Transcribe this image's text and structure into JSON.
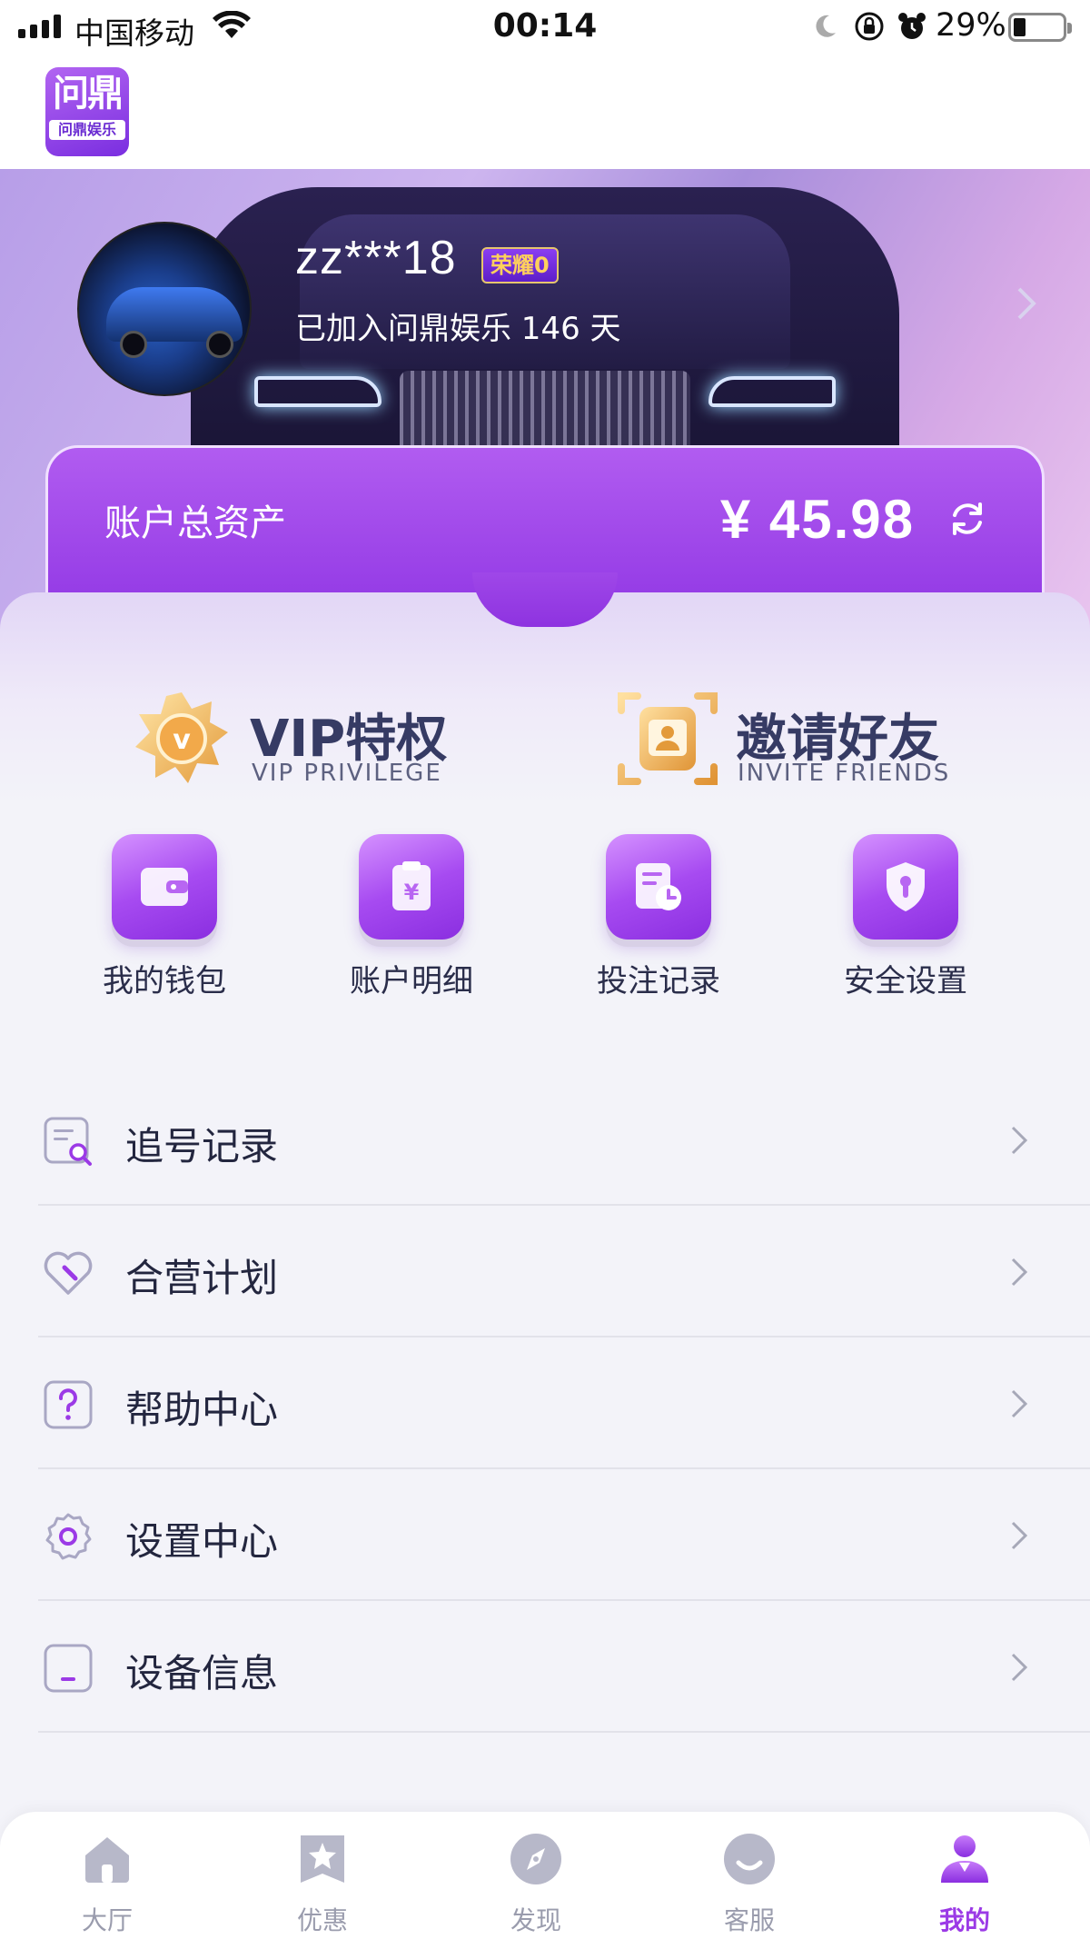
{
  "status_bar": {
    "carrier": "中国移动",
    "time": "00:14",
    "battery": "29%"
  },
  "header": {
    "logo_main": "问鼎",
    "logo_sub": "问鼎娱乐"
  },
  "profile": {
    "username": "zz***18",
    "rank_badge": "荣耀0",
    "joined": "已加入问鼎娱乐 146 天"
  },
  "assets": {
    "label": "账户总资产",
    "value": "¥ 45.98"
  },
  "promos": {
    "vip": {
      "title": "VIP特权",
      "subtitle": "VIP PRIVILEGE"
    },
    "invite": {
      "title": "邀请好友",
      "subtitle": "INVITE FRIENDS"
    }
  },
  "quick_actions": [
    {
      "label": "我的钱包",
      "icon": "wallet-icon"
    },
    {
      "label": "账户明细",
      "icon": "account-detail-icon"
    },
    {
      "label": "投注记录",
      "icon": "bet-record-icon"
    },
    {
      "label": "安全设置",
      "icon": "shield-icon"
    }
  ],
  "menu": [
    {
      "label": "追号记录",
      "icon": "search-record-icon"
    },
    {
      "label": "合营计划",
      "icon": "partnership-icon"
    },
    {
      "label": "帮助中心",
      "icon": "help-icon"
    },
    {
      "label": "设置中心",
      "icon": "gear-icon"
    },
    {
      "label": "设备信息",
      "icon": "device-icon"
    }
  ],
  "tabs": [
    {
      "label": "大厅",
      "icon": "home-icon"
    },
    {
      "label": "优惠",
      "icon": "promo-star-icon"
    },
    {
      "label": "发现",
      "icon": "compass-icon"
    },
    {
      "label": "客服",
      "icon": "support-icon"
    },
    {
      "label": "我的",
      "icon": "user-icon",
      "active": true
    }
  ],
  "colors": {
    "accent": "#9b3ae6",
    "card_gradient_top": "#b15cf0",
    "card_gradient_bottom": "#9036e4"
  }
}
